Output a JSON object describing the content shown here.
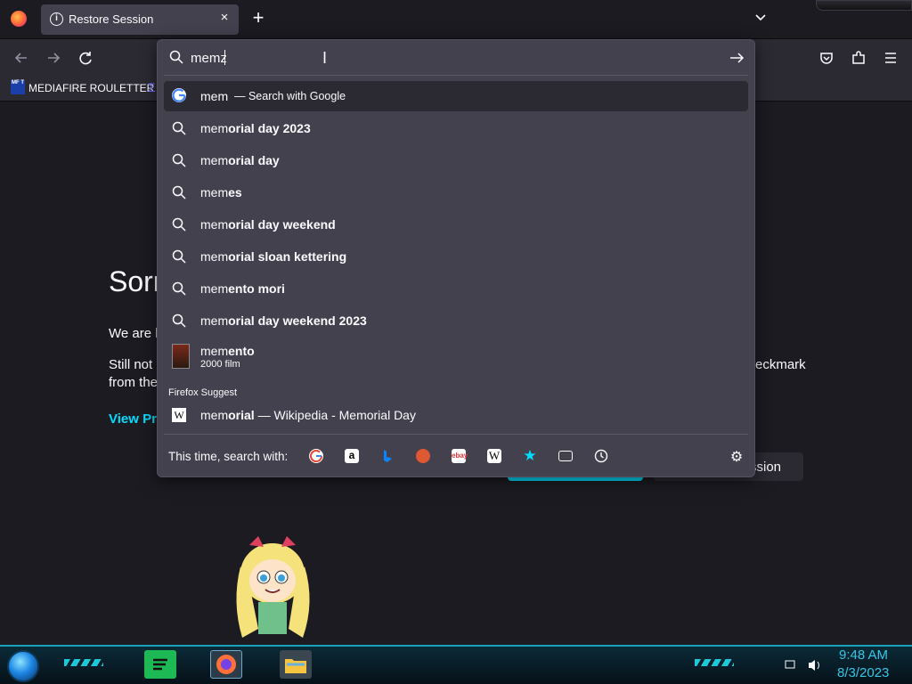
{
  "tab": {
    "title": "Restore Session",
    "close": "×",
    "new_tab": "+"
  },
  "bookmarks": {
    "item_label": "MEDIAFIRE ROULETTER",
    "item_icon": "MF T"
  },
  "page": {
    "heading": "Sorr",
    "line1": "We are h",
    "line2a": "Still not",
    "line2b": "eckmark",
    "line3": "from the",
    "link": "View Pr",
    "secondary_button": "ssion"
  },
  "urlbar": {
    "value": "memz",
    "go_icon": "arrow-right-icon",
    "first_suggestion": {
      "typed": "mem",
      "suffix": "— Search with Google"
    },
    "suggestions": [
      {
        "typed": "mem",
        "completion": "orial day 2023"
      },
      {
        "typed": "mem",
        "completion": "orial day"
      },
      {
        "typed": "mem",
        "completion": "es"
      },
      {
        "typed": "mem",
        "completion": "orial day weekend"
      },
      {
        "typed": "mem",
        "completion": "orial sloan kettering"
      },
      {
        "typed": "mem",
        "completion": "ento mori"
      },
      {
        "typed": "mem",
        "completion": "orial day weekend 2023"
      }
    ],
    "rich_suggestion": {
      "typed": "mem",
      "completion": "ento",
      "subtitle": "2000 film"
    },
    "firefox_suggest_label": "Firefox Suggest",
    "wiki_suggestion": {
      "typed": "mem",
      "completion": "orial",
      "rest": "— Wikipedia - Memorial Day",
      "icon_letter": "W"
    },
    "search_with_label": "This time, search with:",
    "engines": [
      "google-icon",
      "amazon-icon",
      "bing-icon",
      "duckduckgo-icon",
      "ebay-icon",
      "wikipedia-icon",
      "bookmarks-star-icon",
      "tabs-icon",
      "history-icon"
    ]
  },
  "taskbar": {
    "time": "9:48 AM",
    "date": "8/3/2023"
  },
  "colors": {
    "accent": "#00ddff",
    "popup_bg": "#42414d",
    "page_bg": "#1c1b22",
    "taskbar_text": "#33c7e6"
  }
}
